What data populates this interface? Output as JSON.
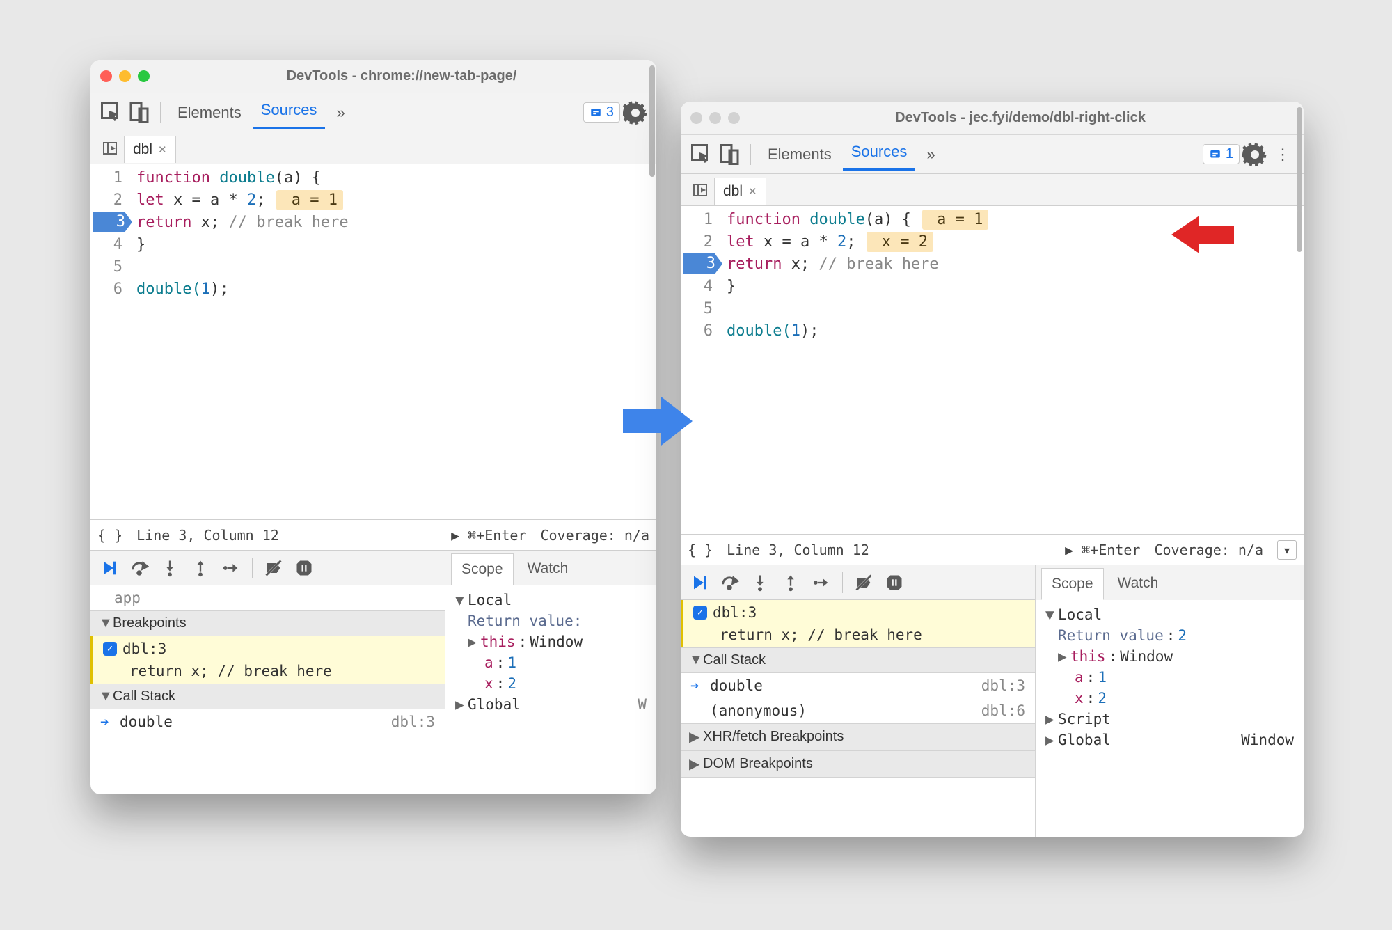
{
  "windows": {
    "w1": {
      "title": "DevTools - chrome://new-tab-page/",
      "traffic_active": true,
      "panel": {
        "elements": "Elements",
        "sources": "Sources",
        "more": "»"
      },
      "issues_count": "3",
      "file_tab": "dbl",
      "code": {
        "lines": [
          {
            "n": "1",
            "txt_kw": "function",
            "txt_name": "double",
            "txt_tail": "(a) {"
          },
          {
            "n": "2",
            "txt_pad": "  ",
            "txt_kw": "let",
            "txt_var": " x = a * ",
            "txt_lit": "2",
            "txt_semi": ";",
            "badge": " a = 1 "
          },
          {
            "n": "3",
            "break": true,
            "txt_pad": "  ",
            "txt_kw": "return",
            "txt_var": " x",
            "txt_semi": "; ",
            "txt_com": "// break here"
          },
          {
            "n": "4",
            "txt_plain": "}"
          },
          {
            "n": "5",
            "txt_plain": ""
          },
          {
            "n": "6",
            "txt_call": "double(",
            "txt_lit": "1",
            "txt_tail": ");"
          }
        ]
      },
      "status": {
        "pos": "Line 3, Column 12",
        "run": "▶ ⌘+Enter",
        "cov": "Coverage: n/a"
      },
      "left_panel": {
        "row_above": "app",
        "breakpoints_hdr": "Breakpoints",
        "bp_label": "dbl:3",
        "bp_code": "return x; // break here",
        "callstack_hdr": "Call Stack",
        "frame_name": "double",
        "frame_loc": "dbl:3"
      },
      "scope": {
        "tabs": {
          "scope": "Scope",
          "watch": "Watch"
        },
        "local": "Local",
        "retval": "Return value:",
        "this_k": "this",
        "this_v": "Window",
        "a_k": "a",
        "a_v": "1",
        "x_k": "x",
        "x_v": "2",
        "global": "Global",
        "global_v": "W"
      }
    },
    "w2": {
      "title": "DevTools - jec.fyi/demo/dbl-right-click",
      "traffic_active": false,
      "panel": {
        "elements": "Elements",
        "sources": "Sources",
        "more": "»"
      },
      "issues_count": "1",
      "file_tab": "dbl",
      "code": {
        "lines": [
          {
            "n": "1",
            "txt_kw": "function",
            "txt_name": "double",
            "txt_tail": "(a) {",
            "badge": " a = 1 "
          },
          {
            "n": "2",
            "txt_pad": "  ",
            "txt_kw": "let",
            "txt_var": " x = a * ",
            "txt_lit": "2",
            "txt_semi": ";",
            "badge": " x = 2 "
          },
          {
            "n": "3",
            "break": true,
            "txt_pad": "  ",
            "txt_kw": "return",
            "txt_var": " x",
            "txt_semi": "; ",
            "txt_com": "// break here"
          },
          {
            "n": "4",
            "txt_plain": "}"
          },
          {
            "n": "5",
            "txt_plain": ""
          },
          {
            "n": "6",
            "txt_call": "double(",
            "txt_lit": "1",
            "txt_tail": ");"
          }
        ]
      },
      "status": {
        "pos": "Line 3, Column 12",
        "run": "▶ ⌘+Enter",
        "cov": "Coverage: n/a"
      },
      "left_panel": {
        "bp_label": "dbl:3",
        "bp_code": "return x; // break here",
        "callstack_hdr": "Call Stack",
        "f1_name": "double",
        "f1_loc": "dbl:3",
        "f2_name": "(anonymous)",
        "f2_loc": "dbl:6",
        "xhr_hdr": "XHR/fetch Breakpoints",
        "dom_hdr": "DOM Breakpoints"
      },
      "scope": {
        "tabs": {
          "scope": "Scope",
          "watch": "Watch"
        },
        "local": "Local",
        "retval_k": "Return value",
        "retval_v": "2",
        "this_k": "this",
        "this_v": "Window",
        "a_k": "a",
        "a_v": "1",
        "x_k": "x",
        "x_v": "2",
        "script": "Script",
        "global": "Global",
        "global_v": "Window"
      }
    }
  }
}
